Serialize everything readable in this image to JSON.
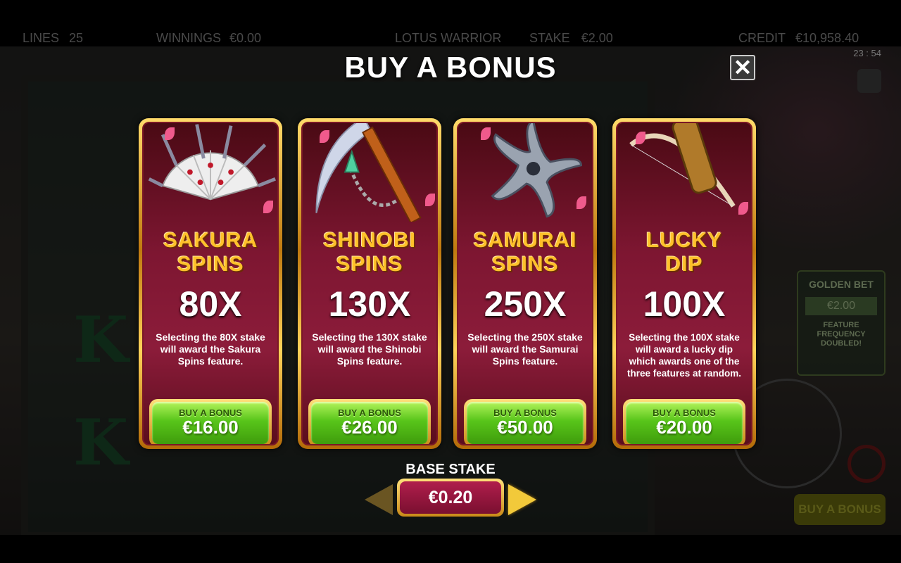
{
  "topbar": {
    "lines_label": "LINES",
    "lines_value": "25",
    "winnings_label": "WINNINGS",
    "winnings_value": "€0.00",
    "game_name": "LOTUS WARRIOR",
    "stake_label": "STAKE",
    "stake_value": "€2.00",
    "credit_label": "CREDIT",
    "credit_value": "€10,958.40"
  },
  "clock": "23 : 54",
  "background": {
    "golden_bet_title": "GOLDEN BET",
    "golden_bet_value": "€2.00",
    "golden_bet_note": "FEATURE FREQUENCY DOUBLED!",
    "buy_bonus_button": "BUY A BONUS"
  },
  "modal": {
    "title": "BUY A BONUS",
    "close_icon": "close-icon",
    "cards": [
      {
        "name_line1": "SAKURA",
        "name_line2": "SPINS",
        "multiplier": "80X",
        "description": "Selecting the 80X stake will award the Sakura Spins feature.",
        "buy_label": "BUY A BONUS",
        "price": "€16.00",
        "icon": "fan-icon"
      },
      {
        "name_line1": "SHINOBI",
        "name_line2": "SPINS",
        "multiplier": "130X",
        "description": "Selecting the 130X stake will award the Shinobi Spins feature.",
        "buy_label": "BUY A BONUS",
        "price": "€26.00",
        "icon": "kusarigama-icon"
      },
      {
        "name_line1": "SAMURAI",
        "name_line2": "SPINS",
        "multiplier": "250X",
        "description": "Selecting the 250X stake will award the Samurai Spins feature.",
        "buy_label": "BUY A BONUS",
        "price": "€50.00",
        "icon": "shuriken-icon"
      },
      {
        "name_line1": "LUCKY",
        "name_line2": "DIP",
        "multiplier": "100X",
        "description": "Selecting the 100X stake will award a lucky dip which awards one of the three features at random.",
        "buy_label": "BUY A BONUS",
        "price": "€20.00",
        "icon": "bow-quiver-icon"
      }
    ],
    "base_stake_label": "BASE STAKE",
    "base_stake_value": "€0.20"
  },
  "colors": {
    "gold": "#ffc12a",
    "card_bg": "#7d1631",
    "buy_green": "#58c51a",
    "petal": "#f05a8c"
  }
}
